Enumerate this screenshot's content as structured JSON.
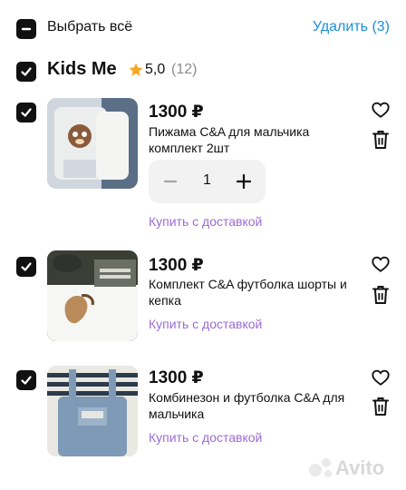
{
  "header": {
    "select_all_label": "Выбрать всё",
    "delete_label": "Удалить (3)"
  },
  "seller": {
    "name": "Kids Me",
    "rating": "5,0",
    "reviews": "(12)"
  },
  "items": [
    {
      "price": "1300 ₽",
      "title": "Пижама C&A для мальчика комплект 2шт",
      "quantity": "1",
      "buy_label": "Купить с доставкой"
    },
    {
      "price": "1300 ₽",
      "title": "Комплект C&A футболка шорты и кепка",
      "buy_label": "Купить с доставкой"
    },
    {
      "price": "1300 ₽",
      "title": "Комбинезон и футболка C&A для мальчика",
      "buy_label": "Купить с доставкой"
    }
  ],
  "watermark": "Avito",
  "colors": {
    "accent_link": "#1a8fe0",
    "buy_link": "#9b6bd4",
    "checkbox": "#111111",
    "star": "#f5a623"
  }
}
